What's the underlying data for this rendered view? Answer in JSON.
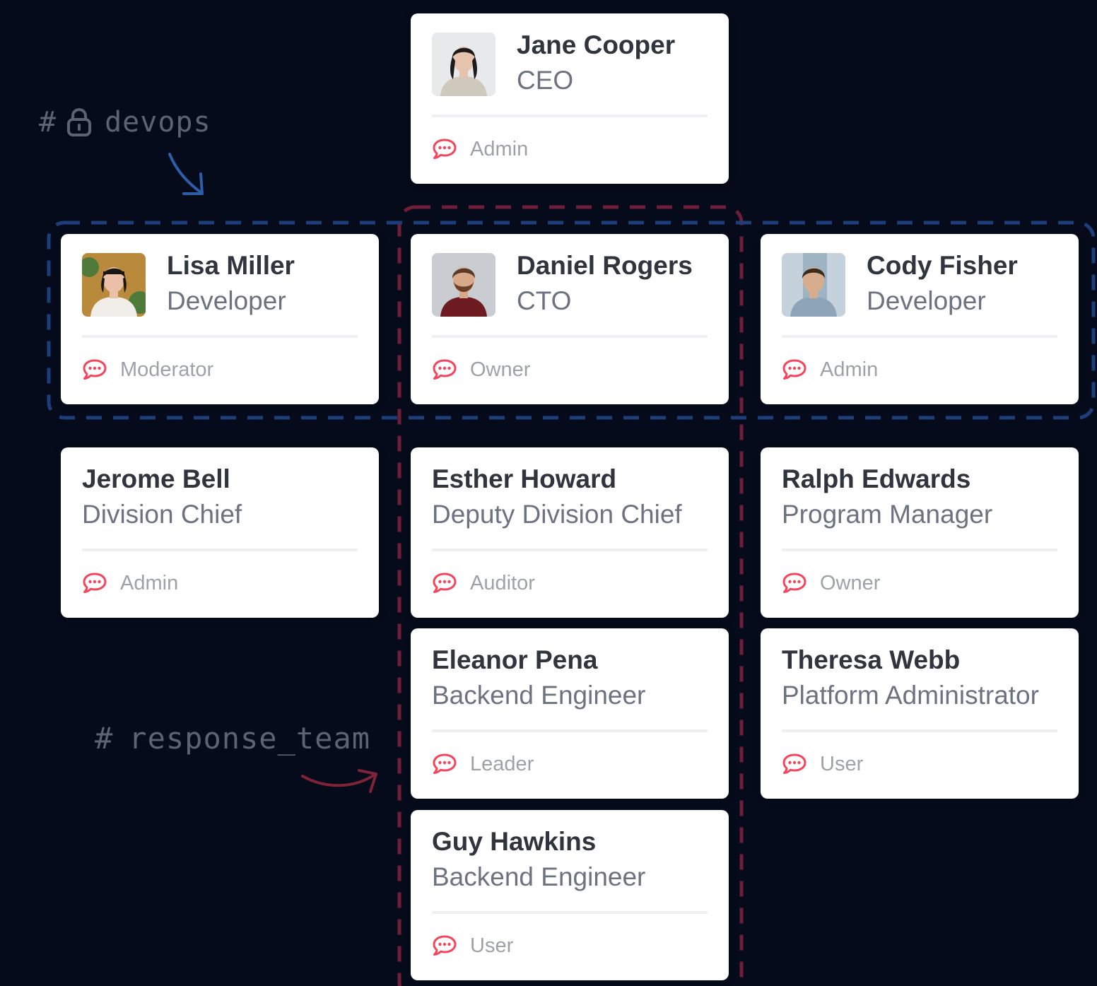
{
  "channels": {
    "devops": {
      "hash": "#",
      "name": "devops",
      "lock_icon": "lock-icon",
      "color": "#1d3e7a"
    },
    "response_team": {
      "hash": "#",
      "name": "response_team",
      "color": "#6e1e38"
    }
  },
  "colors": {
    "background": "#050b1a",
    "card": "#ffffff",
    "role_icon": "#f5455c",
    "name_text": "#2f343d",
    "title_text": "#6c727f",
    "role_text": "#9ea2a8"
  },
  "role_icon": "rocketchat-bubble-icon",
  "people": [
    {
      "id": "jane-cooper",
      "name": "Jane Cooper",
      "title": "CEO",
      "role": "Admin",
      "has_avatar": true
    },
    {
      "id": "lisa-miller",
      "name": "Lisa Miller",
      "title": "Developer",
      "role": "Moderator",
      "has_avatar": true
    },
    {
      "id": "daniel-rogers",
      "name": "Daniel Rogers",
      "title": "CTO",
      "role": "Owner",
      "has_avatar": true
    },
    {
      "id": "cody-fisher",
      "name": "Cody Fisher",
      "title": "Developer",
      "role": "Admin",
      "has_avatar": true
    },
    {
      "id": "jerome-bell",
      "name": "Jerome Bell",
      "title": "Division Chief",
      "role": "Admin",
      "has_avatar": false
    },
    {
      "id": "esther-howard",
      "name": "Esther Howard",
      "title": "Deputy Division Chief",
      "role": "Auditor",
      "has_avatar": false
    },
    {
      "id": "ralph-edwards",
      "name": "Ralph Edwards",
      "title": "Program Manager",
      "role": "Owner",
      "has_avatar": false
    },
    {
      "id": "eleanor-pena",
      "name": "Eleanor Pena",
      "title": "Backend Engineer",
      "role": "Leader",
      "has_avatar": false
    },
    {
      "id": "theresa-webb",
      "name": "Theresa Webb",
      "title": "Platform Administrator",
      "role": "User",
      "has_avatar": false
    },
    {
      "id": "guy-hawkins",
      "name": "Guy Hawkins",
      "title": "Backend Engineer",
      "role": "User",
      "has_avatar": false
    }
  ]
}
